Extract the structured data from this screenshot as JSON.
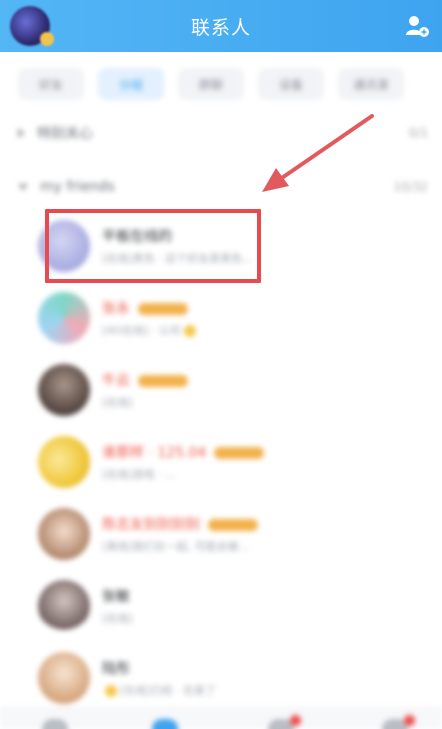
{
  "header": {
    "title": "联系人",
    "add_friend_icon": "add-friend-icon"
  },
  "tabs": [
    {
      "label": "好友",
      "active": false
    },
    {
      "label": "分组",
      "active": true
    },
    {
      "label": "群聊",
      "active": false
    },
    {
      "label": "设备",
      "active": false
    },
    {
      "label": "通讯录",
      "active": false
    }
  ],
  "groups": [
    {
      "label": "特别关心",
      "count": "0/1",
      "expanded": false
    },
    {
      "label": "my friends",
      "count": "10/32",
      "expanded": true
    }
  ],
  "friends": [
    {
      "name": "平板在线的",
      "status": "[在线]黑色 · 这个好友是黑色...",
      "name_color": "normal",
      "vip": false,
      "avatar_color": "#b3b7e8"
    },
    {
      "name": "张永",
      "status": "[4G在线] · 公司",
      "name_color": "red",
      "vip": true,
      "avatar_color": "#7fcfc6"
    },
    {
      "name": "牛云",
      "status": "[在线]",
      "name_color": "red",
      "vip": true,
      "avatar_color": "#6b5a52"
    },
    {
      "name": "谁那样 · 125.04",
      "status": "[在线]游戏 · ...",
      "name_color": "red",
      "vip": true,
      "avatar_color": "#f2d047"
    },
    {
      "name": "陈志友别别别别",
      "status": "[离线]我们在一起, 可能会被...",
      "name_color": "red",
      "vip": true,
      "avatar_color": "#c69a7c"
    },
    {
      "name": "张敏",
      "status": "[在线]",
      "name_color": "normal",
      "vip": false,
      "avatar_color": "#7b6a6a"
    },
    {
      "name": "陆彤",
      "status": "[在线]已经 · 在家了",
      "name_color": "normal",
      "vip": false,
      "avatar_color": "#d9b392"
    }
  ],
  "colors": {
    "header_bg": "#4fb0f3",
    "highlight": "#e84b4f",
    "arrow": "#e35a5e",
    "accent": "#3fa4f0"
  }
}
